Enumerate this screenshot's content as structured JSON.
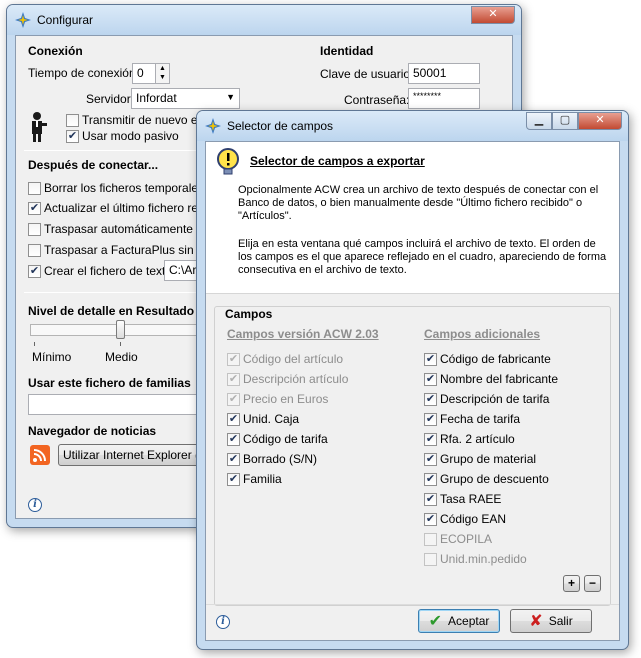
{
  "configurar": {
    "title": "Configurar",
    "close_glyph": "✕",
    "conexion": {
      "heading": "Conexión",
      "timeout_label": "Tiempo de conexión:",
      "timeout_value": "0",
      "servidor_label": "Servidor:",
      "servidor_value": "Infordat",
      "transmitir_label": "Transmitir de nuevo el dir",
      "transmitir_checked": false,
      "pasivo_label": "Usar modo pasivo",
      "pasivo_checked": true
    },
    "identidad": {
      "heading": "Identidad",
      "clave_label": "Clave de usuario:",
      "clave_value": "50001",
      "password_label": "Contraseña:",
      "password_value": "********"
    },
    "despues": {
      "heading": "Después de conectar...",
      "items": [
        {
          "label": "Borrar los ficheros temporales",
          "checked": false
        },
        {
          "label": "Actualizar el último fichero recibid",
          "checked": true
        },
        {
          "label": "Traspasar automáticamente al fic",
          "checked": false
        },
        {
          "label": "Traspasar a FacturaPlus sin preg",
          "checked": false
        },
        {
          "label": "Crear el fichero de texto",
          "checked": true
        }
      ],
      "path_value": "C:\\Arc"
    },
    "nivel": {
      "heading": "Nivel de detalle en Resultado",
      "min_label": "Mínimo",
      "med_label": "Medio"
    },
    "familias": {
      "heading": "Usar este fichero de familias"
    },
    "navegador": {
      "heading": "Navegador de noticias",
      "button_label": "Utilizar Internet Explorer (reco"
    },
    "info_glyph": "i"
  },
  "selector": {
    "title": "Selector de campos",
    "close_glyph": "✕",
    "header_title": "Selector de campos a exportar",
    "desc1": "Opcionalmente ACW crea un archivo de texto después de conectar con el Banco de datos, o bien manualmente desde \"Último fichero recibido\" o \"Artículos\".",
    "desc2": "Elija en esta ventana qué campos incluirá el archivo de texto. El orden de los campos es el que aparece reflejado en el cuadro, apareciendo de forma consecutiva en el archivo de texto.",
    "campos_heading": "Campos",
    "col_left_heading": "Campos versión ACW 2.03",
    "col_right_heading": "Campos adicionales",
    "left_items": [
      {
        "label": "Código del artículo",
        "checked": true,
        "disabled": true
      },
      {
        "label": "Descripción artículo",
        "checked": true,
        "disabled": true
      },
      {
        "label": "Precio en Euros",
        "checked": true,
        "disabled": true
      },
      {
        "label": "Unid. Caja",
        "checked": true,
        "disabled": false
      },
      {
        "label": "Código de tarifa",
        "checked": true,
        "disabled": false
      },
      {
        "label": "Borrado (S/N)",
        "checked": true,
        "disabled": false
      },
      {
        "label": "Familia",
        "checked": true,
        "disabled": false
      }
    ],
    "right_items": [
      {
        "label": "Código de fabricante",
        "checked": true,
        "disabled": false
      },
      {
        "label": "Nombre del fabricante",
        "checked": true,
        "disabled": false
      },
      {
        "label": "Descripción de tarifa",
        "checked": true,
        "disabled": false
      },
      {
        "label": "Fecha de tarifa",
        "checked": true,
        "disabled": false
      },
      {
        "label": "Rfa. 2 artículo",
        "checked": true,
        "disabled": false
      },
      {
        "label": "Grupo de material",
        "checked": true,
        "disabled": false
      },
      {
        "label": "Grupo de descuento",
        "checked": true,
        "disabled": false
      },
      {
        "label": "Tasa RAEE",
        "checked": true,
        "disabled": false
      },
      {
        "label": "Código EAN",
        "checked": true,
        "disabled": false
      },
      {
        "label": "ECOPILA",
        "checked": false,
        "disabled": true
      },
      {
        "label": "Unid.min.pedido",
        "checked": false,
        "disabled": true
      }
    ],
    "plus_label": "+",
    "minus_label": "−",
    "aceptar_label": "Aceptar",
    "salir_label": "Salir",
    "info_glyph": "i"
  },
  "colors": {
    "accent": "#2d5d9a",
    "window_frame": "#c6dbf0",
    "rss": "#f26522"
  }
}
